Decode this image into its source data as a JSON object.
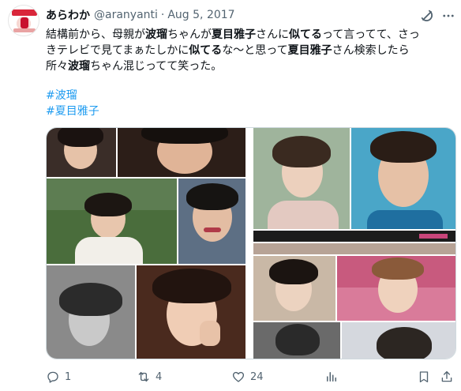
{
  "tweet": {
    "author_name": "あらわか",
    "handle": "@aranyanti",
    "separator": "·",
    "date": "Aug 5, 2017",
    "lines": [
      [
        {
          "t": "結構前から、母親が",
          "b": false
        },
        {
          "t": "波瑠",
          "b": true
        },
        {
          "t": "ちゃんが",
          "b": false
        },
        {
          "t": "夏目雅子",
          "b": true
        },
        {
          "t": "さんに",
          "b": false
        },
        {
          "t": "似てる",
          "b": true
        },
        {
          "t": "って言ってて、さっ",
          "b": false
        }
      ],
      [
        {
          "t": "きテレビで見てまぁたしかに",
          "b": false
        },
        {
          "t": "似てる",
          "b": true
        },
        {
          "t": "な〜と思って",
          "b": false
        },
        {
          "t": "夏目雅子",
          "b": true
        },
        {
          "t": "さん検索したら",
          "b": false
        }
      ],
      [
        {
          "t": "所々",
          "b": false
        },
        {
          "t": "波瑠",
          "b": true
        },
        {
          "t": "ちゃん混じってて笑った。",
          "b": false
        }
      ]
    ],
    "hashtags": [
      "#波瑠",
      "#夏目雅子"
    ]
  },
  "actions": {
    "reply_count": "1",
    "retweet_count": "4",
    "like_count": "24"
  },
  "icons": {
    "grok": "grok-icon",
    "more": "more-options-icon",
    "reply": "reply-icon",
    "retweet": "retweet-icon",
    "like": "heart-icon",
    "views": "views-icon",
    "bookmark": "bookmark-icon",
    "share": "share-icon"
  },
  "colors": {
    "link": "#1d9bf0",
    "secondary_text": "#536471",
    "border": "#cfd9de"
  }
}
